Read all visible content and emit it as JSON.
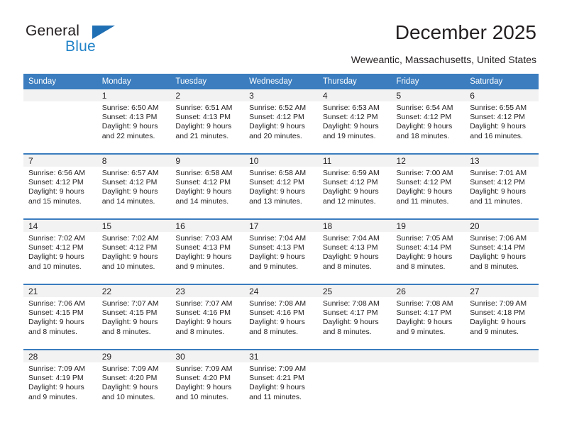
{
  "brand": {
    "name_part1": "General",
    "name_part2": "Blue",
    "triangle_color": "#1f6fb4",
    "blue_color": "#2283c8"
  },
  "header": {
    "title": "December 2025",
    "location": "Weweantic, Massachusetts, United States"
  },
  "calendar": {
    "header_bg": "#3b7dbf",
    "daynum_bg": "#f2f2f2",
    "weekdays": [
      "Sunday",
      "Monday",
      "Tuesday",
      "Wednesday",
      "Thursday",
      "Friday",
      "Saturday"
    ],
    "weeks": [
      [
        {
          "day": "",
          "sunrise": "",
          "sunset": "",
          "daylight1": "",
          "daylight2": ""
        },
        {
          "day": "1",
          "sunrise": "Sunrise: 6:50 AM",
          "sunset": "Sunset: 4:13 PM",
          "daylight1": "Daylight: 9 hours",
          "daylight2": "and 22 minutes."
        },
        {
          "day": "2",
          "sunrise": "Sunrise: 6:51 AM",
          "sunset": "Sunset: 4:13 PM",
          "daylight1": "Daylight: 9 hours",
          "daylight2": "and 21 minutes."
        },
        {
          "day": "3",
          "sunrise": "Sunrise: 6:52 AM",
          "sunset": "Sunset: 4:12 PM",
          "daylight1": "Daylight: 9 hours",
          "daylight2": "and 20 minutes."
        },
        {
          "day": "4",
          "sunrise": "Sunrise: 6:53 AM",
          "sunset": "Sunset: 4:12 PM",
          "daylight1": "Daylight: 9 hours",
          "daylight2": "and 19 minutes."
        },
        {
          "day": "5",
          "sunrise": "Sunrise: 6:54 AM",
          "sunset": "Sunset: 4:12 PM",
          "daylight1": "Daylight: 9 hours",
          "daylight2": "and 18 minutes."
        },
        {
          "day": "6",
          "sunrise": "Sunrise: 6:55 AM",
          "sunset": "Sunset: 4:12 PM",
          "daylight1": "Daylight: 9 hours",
          "daylight2": "and 16 minutes."
        }
      ],
      [
        {
          "day": "7",
          "sunrise": "Sunrise: 6:56 AM",
          "sunset": "Sunset: 4:12 PM",
          "daylight1": "Daylight: 9 hours",
          "daylight2": "and 15 minutes."
        },
        {
          "day": "8",
          "sunrise": "Sunrise: 6:57 AM",
          "sunset": "Sunset: 4:12 PM",
          "daylight1": "Daylight: 9 hours",
          "daylight2": "and 14 minutes."
        },
        {
          "day": "9",
          "sunrise": "Sunrise: 6:58 AM",
          "sunset": "Sunset: 4:12 PM",
          "daylight1": "Daylight: 9 hours",
          "daylight2": "and 14 minutes."
        },
        {
          "day": "10",
          "sunrise": "Sunrise: 6:58 AM",
          "sunset": "Sunset: 4:12 PM",
          "daylight1": "Daylight: 9 hours",
          "daylight2": "and 13 minutes."
        },
        {
          "day": "11",
          "sunrise": "Sunrise: 6:59 AM",
          "sunset": "Sunset: 4:12 PM",
          "daylight1": "Daylight: 9 hours",
          "daylight2": "and 12 minutes."
        },
        {
          "day": "12",
          "sunrise": "Sunrise: 7:00 AM",
          "sunset": "Sunset: 4:12 PM",
          "daylight1": "Daylight: 9 hours",
          "daylight2": "and 11 minutes."
        },
        {
          "day": "13",
          "sunrise": "Sunrise: 7:01 AM",
          "sunset": "Sunset: 4:12 PM",
          "daylight1": "Daylight: 9 hours",
          "daylight2": "and 11 minutes."
        }
      ],
      [
        {
          "day": "14",
          "sunrise": "Sunrise: 7:02 AM",
          "sunset": "Sunset: 4:12 PM",
          "daylight1": "Daylight: 9 hours",
          "daylight2": "and 10 minutes."
        },
        {
          "day": "15",
          "sunrise": "Sunrise: 7:02 AM",
          "sunset": "Sunset: 4:12 PM",
          "daylight1": "Daylight: 9 hours",
          "daylight2": "and 10 minutes."
        },
        {
          "day": "16",
          "sunrise": "Sunrise: 7:03 AM",
          "sunset": "Sunset: 4:13 PM",
          "daylight1": "Daylight: 9 hours",
          "daylight2": "and 9 minutes."
        },
        {
          "day": "17",
          "sunrise": "Sunrise: 7:04 AM",
          "sunset": "Sunset: 4:13 PM",
          "daylight1": "Daylight: 9 hours",
          "daylight2": "and 9 minutes."
        },
        {
          "day": "18",
          "sunrise": "Sunrise: 7:04 AM",
          "sunset": "Sunset: 4:13 PM",
          "daylight1": "Daylight: 9 hours",
          "daylight2": "and 8 minutes."
        },
        {
          "day": "19",
          "sunrise": "Sunrise: 7:05 AM",
          "sunset": "Sunset: 4:14 PM",
          "daylight1": "Daylight: 9 hours",
          "daylight2": "and 8 minutes."
        },
        {
          "day": "20",
          "sunrise": "Sunrise: 7:06 AM",
          "sunset": "Sunset: 4:14 PM",
          "daylight1": "Daylight: 9 hours",
          "daylight2": "and 8 minutes."
        }
      ],
      [
        {
          "day": "21",
          "sunrise": "Sunrise: 7:06 AM",
          "sunset": "Sunset: 4:15 PM",
          "daylight1": "Daylight: 9 hours",
          "daylight2": "and 8 minutes."
        },
        {
          "day": "22",
          "sunrise": "Sunrise: 7:07 AM",
          "sunset": "Sunset: 4:15 PM",
          "daylight1": "Daylight: 9 hours",
          "daylight2": "and 8 minutes."
        },
        {
          "day": "23",
          "sunrise": "Sunrise: 7:07 AM",
          "sunset": "Sunset: 4:16 PM",
          "daylight1": "Daylight: 9 hours",
          "daylight2": "and 8 minutes."
        },
        {
          "day": "24",
          "sunrise": "Sunrise: 7:08 AM",
          "sunset": "Sunset: 4:16 PM",
          "daylight1": "Daylight: 9 hours",
          "daylight2": "and 8 minutes."
        },
        {
          "day": "25",
          "sunrise": "Sunrise: 7:08 AM",
          "sunset": "Sunset: 4:17 PM",
          "daylight1": "Daylight: 9 hours",
          "daylight2": "and 8 minutes."
        },
        {
          "day": "26",
          "sunrise": "Sunrise: 7:08 AM",
          "sunset": "Sunset: 4:17 PM",
          "daylight1": "Daylight: 9 hours",
          "daylight2": "and 9 minutes."
        },
        {
          "day": "27",
          "sunrise": "Sunrise: 7:09 AM",
          "sunset": "Sunset: 4:18 PM",
          "daylight1": "Daylight: 9 hours",
          "daylight2": "and 9 minutes."
        }
      ],
      [
        {
          "day": "28",
          "sunrise": "Sunrise: 7:09 AM",
          "sunset": "Sunset: 4:19 PM",
          "daylight1": "Daylight: 9 hours",
          "daylight2": "and 9 minutes."
        },
        {
          "day": "29",
          "sunrise": "Sunrise: 7:09 AM",
          "sunset": "Sunset: 4:20 PM",
          "daylight1": "Daylight: 9 hours",
          "daylight2": "and 10 minutes."
        },
        {
          "day": "30",
          "sunrise": "Sunrise: 7:09 AM",
          "sunset": "Sunset: 4:20 PM",
          "daylight1": "Daylight: 9 hours",
          "daylight2": "and 10 minutes."
        },
        {
          "day": "31",
          "sunrise": "Sunrise: 7:09 AM",
          "sunset": "Sunset: 4:21 PM",
          "daylight1": "Daylight: 9 hours",
          "daylight2": "and 11 minutes."
        },
        {
          "day": "",
          "sunrise": "",
          "sunset": "",
          "daylight1": "",
          "daylight2": ""
        },
        {
          "day": "",
          "sunrise": "",
          "sunset": "",
          "daylight1": "",
          "daylight2": ""
        },
        {
          "day": "",
          "sunrise": "",
          "sunset": "",
          "daylight1": "",
          "daylight2": ""
        }
      ]
    ]
  }
}
